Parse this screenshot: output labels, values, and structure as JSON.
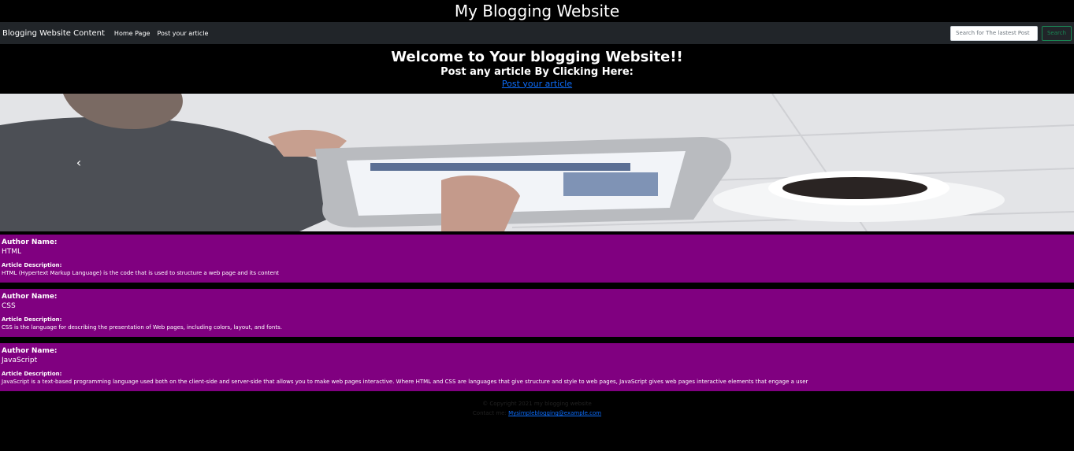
{
  "site_title": "My Blogging Website",
  "navbar": {
    "brand": "Blogging Website Content",
    "links": [
      {
        "label": "Home Page"
      },
      {
        "label": "Post your article"
      }
    ],
    "search_placeholder": "Search for The lastest Post",
    "search_button": "Search"
  },
  "hero": {
    "heading": "Welcome to Your blogging Website!!",
    "subheading": "Post any article By Clicking Here:",
    "link_text": "Post your article"
  },
  "carousel": {
    "prev_icon": "chevron-left-icon"
  },
  "articles": [
    {
      "author_label": "Author Name:",
      "author": "HTML",
      "description_label": "Article Description:",
      "description": "HTML (Hypertext Markup Language) is the code that is used to structure a web page and its content"
    },
    {
      "author_label": "Author Name:",
      "author": "CSS",
      "description_label": "Article Description:",
      "description": "CSS is the language for describing the presentation of Web pages, including colors, layout, and fonts."
    },
    {
      "author_label": "Author Name:",
      "author": "JavaScript",
      "description_label": "Article Description:",
      "description": "JavaScript is a text-based programming language used both on the client-side and server-side that allows you to make web pages interactive. Where HTML and CSS are languages that give structure and style to web pages, JavaScript gives web pages interactive elements that engage a user"
    }
  ],
  "footer": {
    "copyright": "© Copyright 2021 my blogging website",
    "contact_label": "Contact me:",
    "contact_email": "Mysimpleblogging@example.com"
  },
  "colors": {
    "background": "#000000",
    "navbar": "#212529",
    "article_bg": "#800080",
    "link": "#0d6efd",
    "search_button": "#198754"
  }
}
